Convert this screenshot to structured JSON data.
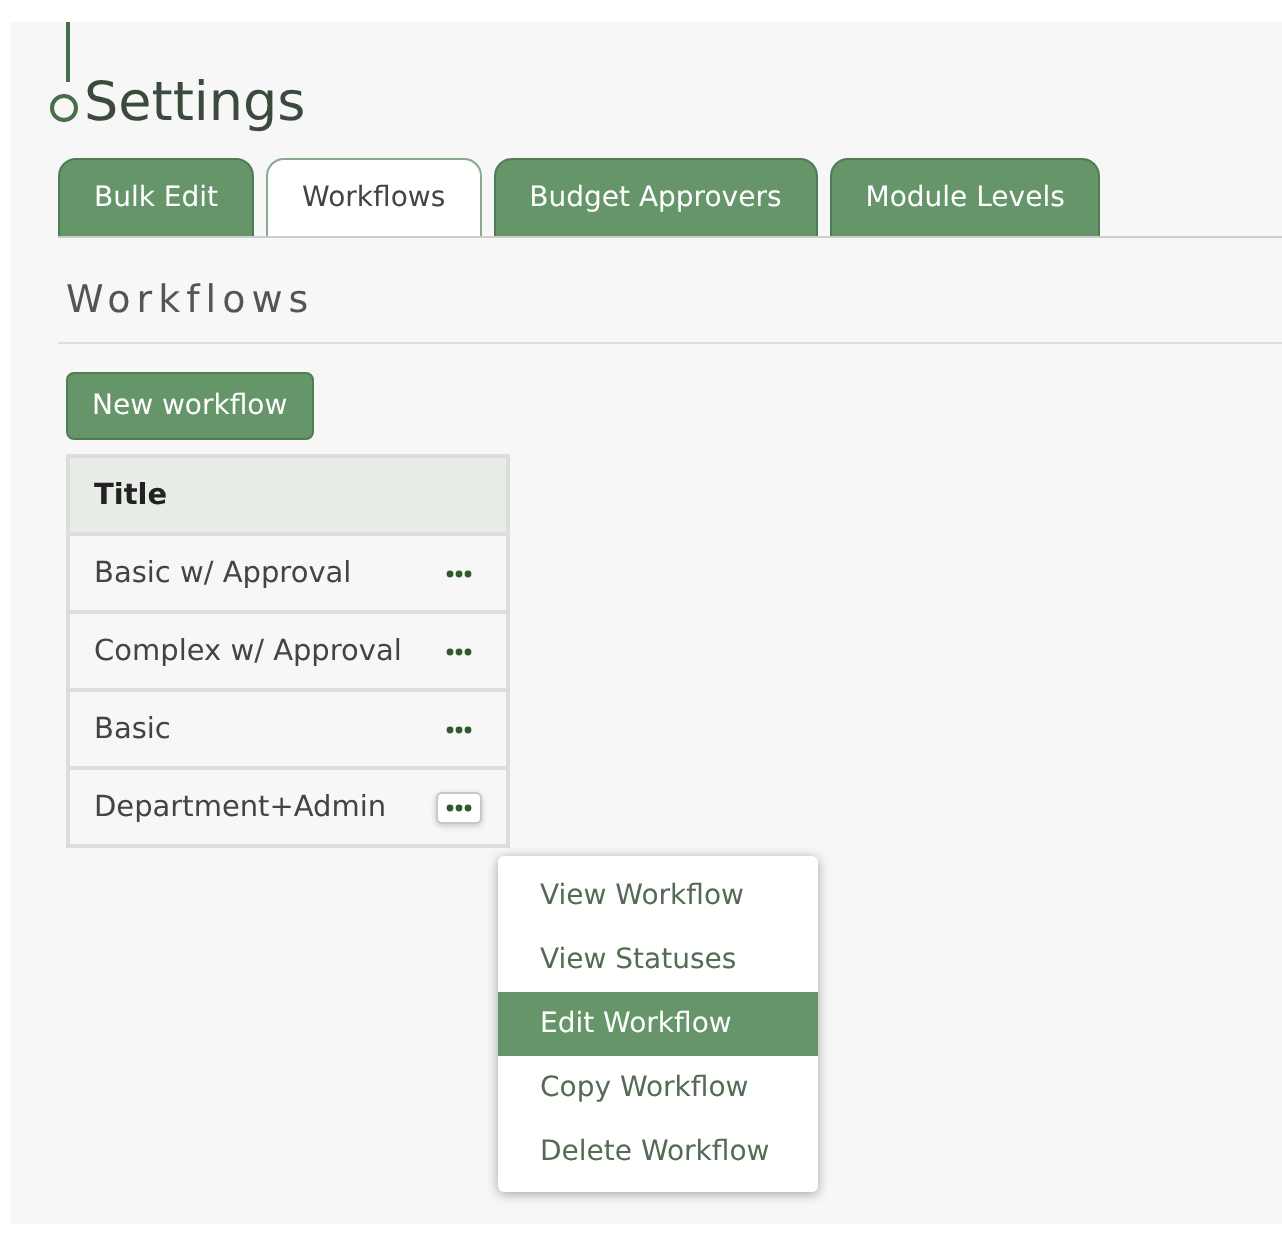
{
  "page": {
    "title": "Settings"
  },
  "tabs": [
    {
      "label": "Bulk Edit",
      "selected": false
    },
    {
      "label": "Workflows",
      "selected": true
    },
    {
      "label": "Budget Approvers",
      "selected": false
    },
    {
      "label": "Module Levels",
      "selected": false
    }
  ],
  "section": {
    "heading": "Workflows",
    "new_button": "New workflow"
  },
  "table": {
    "columns": [
      "Title"
    ],
    "rows": [
      {
        "title": "Basic w/ Approval",
        "menu_open": false
      },
      {
        "title": "Complex w/ Approval",
        "menu_open": false
      },
      {
        "title": "Basic",
        "menu_open": false
      },
      {
        "title": "Department+Admin",
        "menu_open": true
      }
    ]
  },
  "context_menu": {
    "items": [
      {
        "label": "View Workflow",
        "selected": false
      },
      {
        "label": "View Statuses",
        "selected": false
      },
      {
        "label": "Edit Workflow",
        "selected": true
      },
      {
        "label": "Copy Workflow",
        "selected": false
      },
      {
        "label": "Delete Workflow",
        "selected": false
      }
    ]
  }
}
